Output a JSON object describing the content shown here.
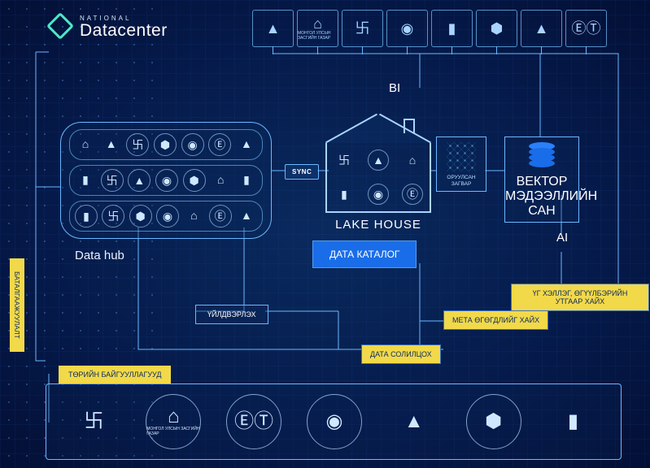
{
  "brand": {
    "top": "NATIONAL",
    "main": "Datacenter"
  },
  "labels": {
    "bi": "BI",
    "ai": "AI",
    "sync": "SYNC",
    "datahub": "Data hub",
    "lakehouse": "LAKE HOUSE",
    "catalog": "ДАТА КАТАЛОГ",
    "embed": "ОРУУЛСАН ЗАГВАР",
    "vector": "ВЕКТОР МЭДЭЭЛЛИЙН САН",
    "process": "ҮЙЛДВЭРЛЭХ",
    "validation": "БАТАЛГААЖУУЛАЛТ",
    "gov": "ТӨРИЙН БАЙГУУЛЛАГУУД",
    "y1": "ҮГ ХЭЛЛЭГ, ӨГҮҮЛБЭРИЙН УТГААР ХАЙХ",
    "y2": "МЕТА ӨГӨГДЛИЙГ ХАЙХ",
    "y3": "ДАТА СОЛИЛЦОХ"
  },
  "top_icons": [
    {
      "glyph": "▲",
      "text": ""
    },
    {
      "glyph": "⌂",
      "text": "МОНГОЛ УЛСЫН ЗАСГИЙН ГАЗАР"
    },
    {
      "glyph": "卐",
      "text": ""
    },
    {
      "glyph": "◉",
      "text": ""
    },
    {
      "glyph": "▮",
      "text": ""
    },
    {
      "glyph": "⬢",
      "text": ""
    },
    {
      "glyph": "▲",
      "text": ""
    },
    {
      "glyph": "ⒺⓉ",
      "text": ""
    }
  ],
  "bottom_icons": [
    {
      "glyph": "卐",
      "text": ""
    },
    {
      "glyph": "⌂",
      "text": "МОНГОЛ УЛСЫН ЗАСГИЙН ГАЗАР"
    },
    {
      "glyph": "ⒺⓉ",
      "text": ""
    },
    {
      "glyph": "◉",
      "text": ""
    },
    {
      "glyph": "▲",
      "text": ""
    },
    {
      "glyph": "⬢",
      "text": ""
    },
    {
      "glyph": "▮",
      "text": ""
    }
  ]
}
